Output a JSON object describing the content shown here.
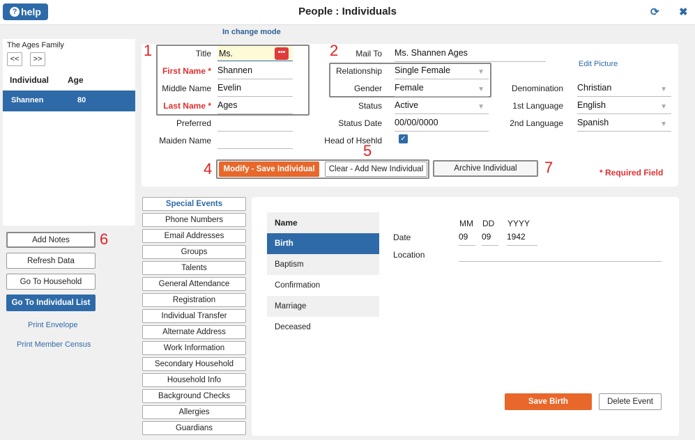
{
  "header": {
    "help_label": "help",
    "title": "People : Individuals"
  },
  "status": {
    "mode": "In change mode"
  },
  "family": {
    "name": "The Ages Family",
    "prev_label": "<<",
    "next_label": ">>",
    "col_individual": "Individual",
    "col_age": "Age",
    "rows": [
      {
        "name": "Shannen",
        "age": "80"
      }
    ]
  },
  "left_actions": {
    "add_notes": "Add Notes",
    "refresh": "Refresh Data",
    "go_household": "Go To Household",
    "go_list": "Go To Individual List",
    "print_envelope": "Print Envelope",
    "print_census": "Print Member Census"
  },
  "form": {
    "title_label": "Title",
    "title_value": "Ms.",
    "first_label": "First Name *",
    "first_value": "Shannen",
    "middle_label": "Middle Name",
    "middle_value": "Evelin",
    "last_label": "Last Name *",
    "last_value": "Ages",
    "preferred_label": "Preferred",
    "preferred_value": "",
    "maiden_label": "Maiden Name",
    "maiden_value": "",
    "mailto_label": "Mail To",
    "mailto_value": "Ms. Shannen Ages",
    "relationship_label": "Relationship",
    "relationship_value": "Single Female",
    "gender_label": "Gender",
    "gender_value": "Female",
    "status_label": "Status",
    "status_value": "Active",
    "statusdate_label": "Status Date",
    "statusdate_value": "00/00/0000",
    "head_label": "Head of Hsehld",
    "head_checked": true,
    "edit_picture": "Edit Picture",
    "denomination_label": "Denomination",
    "denomination_value": "Christian",
    "lang1_label": "1st Language",
    "lang1_value": "English",
    "lang2_label": "2nd Language",
    "lang2_value": "Spanish",
    "required_note": "* Required Field"
  },
  "actions": {
    "modify_save": "Modify - Save Individual",
    "clear_add": "Clear - Add New Individual",
    "archive": "Archive Individual"
  },
  "annotations": [
    "1",
    "2",
    "4",
    "5",
    "6",
    "7"
  ],
  "tabs": [
    "Special Events",
    "Phone Numbers",
    "Email Addresses",
    "Groups",
    "Talents",
    "General Attendance",
    "Registration",
    "Individual Transfer",
    "Alternate Address",
    "Work Information",
    "Secondary Household",
    "Household Info",
    "Background Checks",
    "Allergies",
    "Guardians"
  ],
  "events": {
    "header": "Name",
    "items": [
      "Birth",
      "Baptism",
      "Confirmation",
      "Marriage",
      "Deceased"
    ],
    "selected": "Birth",
    "date_label": "Date",
    "location_label": "Location",
    "mm_label": "MM",
    "dd_label": "DD",
    "yyyy_label": "YYYY",
    "mm": "09",
    "dd": "09",
    "yyyy": "1942",
    "location_value": "",
    "save_label": "Save Birth",
    "delete_label": "Delete Event"
  },
  "colors": {
    "accent": "#2e6aa8",
    "orange": "#e8672a",
    "required": "#e03030",
    "annotation": "#e02020"
  }
}
